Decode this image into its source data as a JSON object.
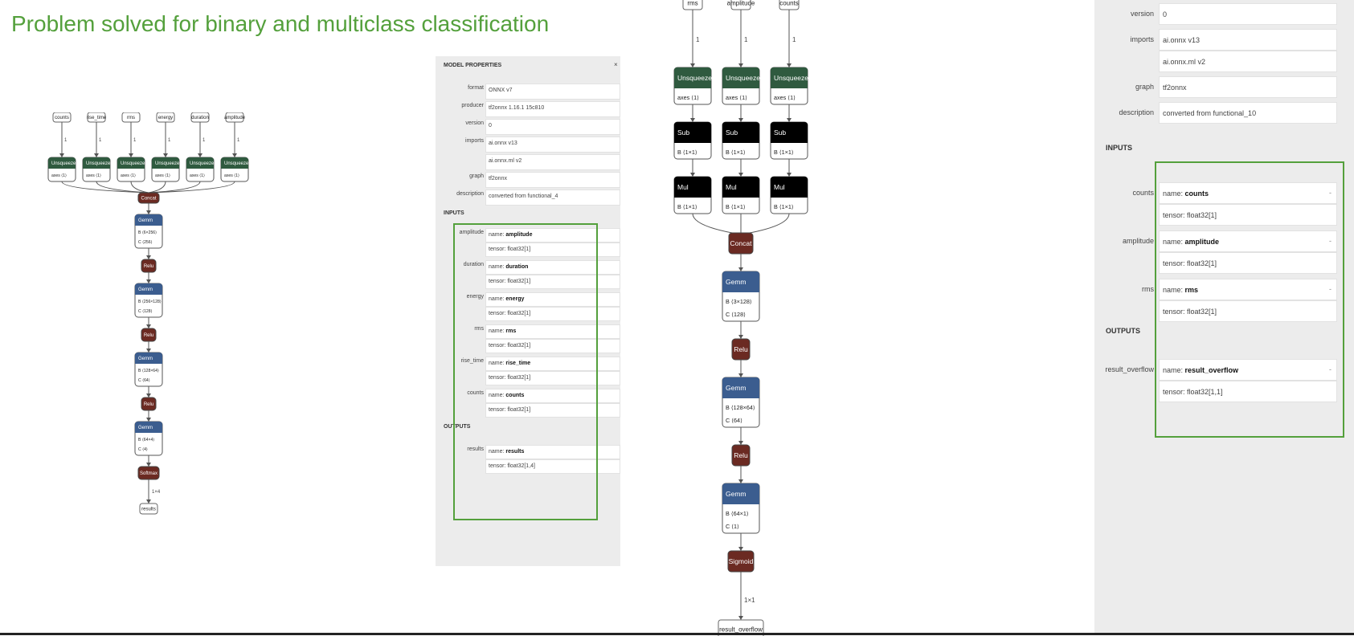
{
  "slide": {
    "title": "Problem solved for binary and multiclass classification"
  },
  "colors": {
    "accent": "#54a03c",
    "unsqueeze": "#2f5a3f",
    "gemm": "#3b5d8f",
    "activation": "#6b2a22",
    "sub_mul": "#000000"
  },
  "graph_left": {
    "inputs": [
      "counts",
      "rise_time",
      "rms",
      "energy",
      "duration",
      "amplitude"
    ],
    "edge_labels": [
      "1",
      "1",
      "1",
      "1",
      "1",
      "1"
    ],
    "unsqueeze": {
      "label": "Unsqueeze",
      "attr": "axes",
      "val": "⟨1⟩"
    },
    "concat": "Concat",
    "layers": [
      {
        "op": "Gemm",
        "b": "B ⟨6×256⟩",
        "c": "C ⟨256⟩"
      },
      {
        "op": "Relu"
      },
      {
        "op": "Gemm",
        "b": "B ⟨256×128⟩",
        "c": "C ⟨128⟩"
      },
      {
        "op": "Relu"
      },
      {
        "op": "Gemm",
        "b": "B ⟨128×64⟩",
        "c": "C ⟨64⟩"
      },
      {
        "op": "Relu"
      },
      {
        "op": "Gemm",
        "b": "B ⟨64×4⟩",
        "c": "C ⟨4⟩"
      },
      {
        "op": "Softmax"
      }
    ],
    "output_edge": "1×4",
    "output": "results"
  },
  "props_left": {
    "header": "MODEL PROPERTIES",
    "close": "×",
    "rows": [
      {
        "label": "format",
        "values": [
          "ONNX v7"
        ]
      },
      {
        "label": "producer",
        "values": [
          "tf2onnx 1.16.1 15c810"
        ]
      },
      {
        "label": "version",
        "values": [
          "0"
        ]
      },
      {
        "label": "imports",
        "values": [
          "ai.onnx v13",
          "ai.onnx.ml v2"
        ]
      },
      {
        "label": "graph",
        "values": [
          "tf2onnx"
        ]
      },
      {
        "label": "description",
        "values": [
          "converted from functional_4"
        ]
      }
    ],
    "inputs_title": "INPUTS",
    "inputs": [
      {
        "label": "amplitude",
        "name": "amplitude",
        "tensor": "float32[1]"
      },
      {
        "label": "duration",
        "name": "duration",
        "tensor": "float32[1]"
      },
      {
        "label": "energy",
        "name": "energy",
        "tensor": "float32[1]"
      },
      {
        "label": "rms",
        "name": "rms",
        "tensor": "float32[1]"
      },
      {
        "label": "rise_time",
        "name": "rise_time",
        "tensor": "float32[1]"
      },
      {
        "label": "counts",
        "name": "counts",
        "tensor": "float32[1]"
      }
    ],
    "outputs_title": "OUTPUTS",
    "outputs": [
      {
        "label": "results",
        "name": "results",
        "tensor": "float32[1,4]"
      }
    ],
    "name_prefix": "name:",
    "tensor_prefix": "tensor:"
  },
  "graph_center": {
    "inputs": [
      "rms",
      "amplitude",
      "counts"
    ],
    "edge_labels": [
      "1",
      "1",
      "1"
    ],
    "unsqueeze": {
      "label": "Unsqueeze",
      "attr": "axes",
      "val": "⟨1⟩"
    },
    "sub": {
      "label": "Sub",
      "b": "B ⟨1×1⟩"
    },
    "mul": {
      "label": "Mul",
      "b": "B ⟨1×1⟩"
    },
    "concat": "Concat",
    "layers": [
      {
        "op": "Gemm",
        "b": "B ⟨3×128⟩",
        "c": "C ⟨128⟩"
      },
      {
        "op": "Relu"
      },
      {
        "op": "Gemm",
        "b": "B ⟨128×64⟩",
        "c": "C ⟨64⟩"
      },
      {
        "op": "Relu"
      },
      {
        "op": "Gemm",
        "b": "B ⟨64×1⟩",
        "c": "C ⟨1⟩"
      },
      {
        "op": "Sigmoid"
      }
    ],
    "output_edge": "1×1",
    "output": "result_overflow"
  },
  "props_right": {
    "rows": [
      {
        "label": "version",
        "values": [
          "0"
        ]
      },
      {
        "label": "imports",
        "values": [
          "ai.onnx v13",
          "ai.onnx.ml v2"
        ]
      },
      {
        "label": "graph",
        "values": [
          "tf2onnx"
        ]
      },
      {
        "label": "description",
        "values": [
          "converted from functional_10"
        ]
      }
    ],
    "inputs_title": "INPUTS",
    "inputs": [
      {
        "label": "counts",
        "name": "counts",
        "tensor": "float32[1]"
      },
      {
        "label": "amplitude",
        "name": "amplitude",
        "tensor": "float32[1]"
      },
      {
        "label": "rms",
        "name": "rms",
        "tensor": "float32[1]"
      }
    ],
    "outputs_title": "OUTPUTS",
    "outputs": [
      {
        "label": "result_overflow",
        "name": "result_overflow",
        "tensor": "float32[1,1]"
      }
    ],
    "name_prefix": "name:",
    "tensor_prefix": "tensor:",
    "row_marker": "-"
  }
}
